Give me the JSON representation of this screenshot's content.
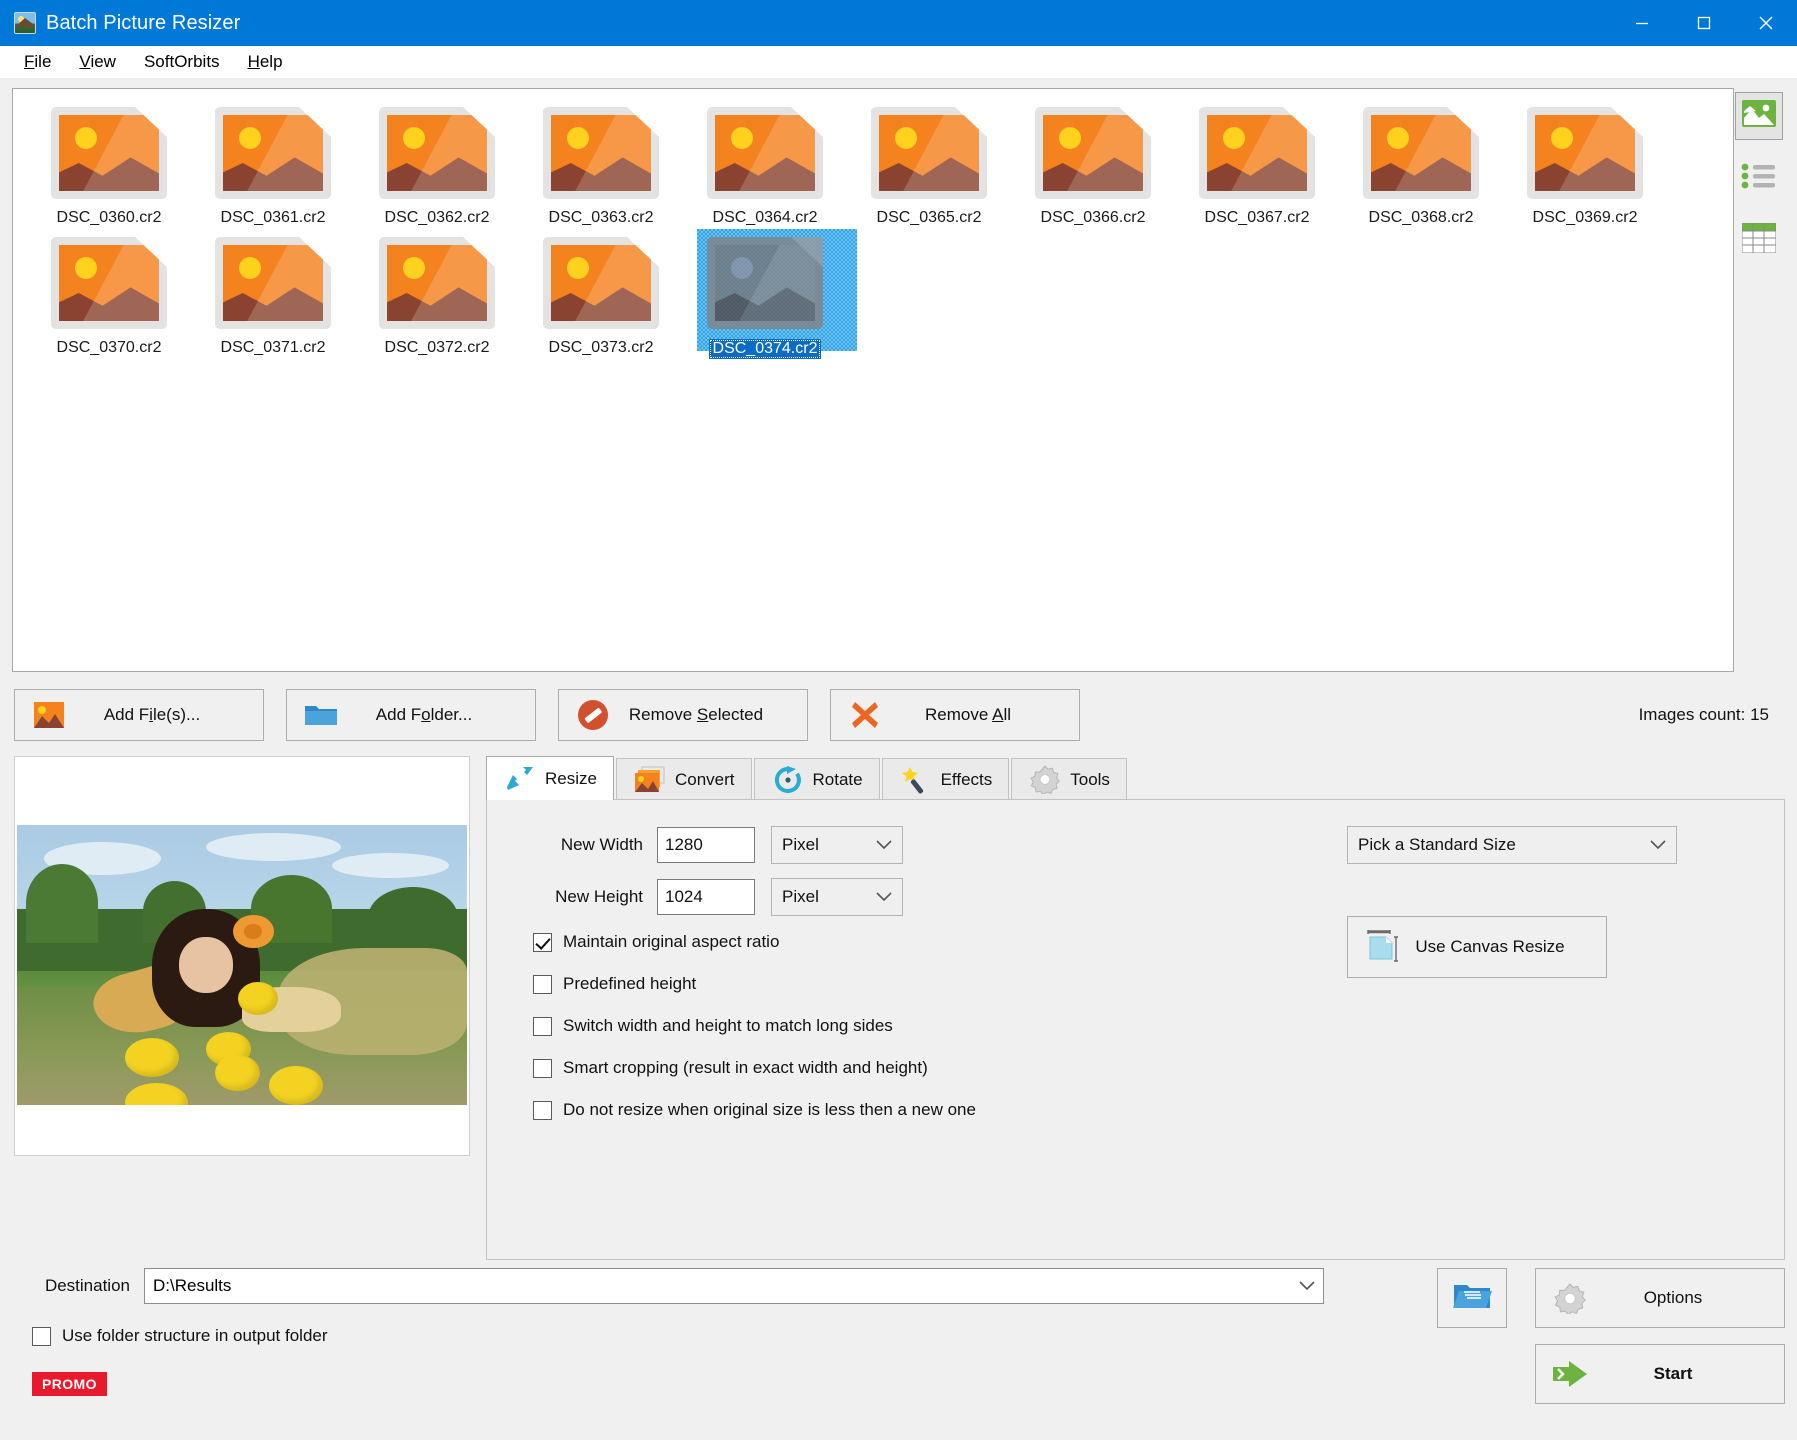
{
  "window": {
    "title": "Batch Picture Resizer",
    "icon": "app-picture-icon",
    "minimize": "—",
    "maximize": "□",
    "close": "✕"
  },
  "menu": [
    {
      "label": "File",
      "accel": "F"
    },
    {
      "label": "View",
      "accel": "V"
    },
    {
      "label": "SoftOrbits",
      "accel": ""
    },
    {
      "label": "Help",
      "accel": "H"
    }
  ],
  "file_list": {
    "items": [
      {
        "name": "DSC_0360.cr2",
        "selected": false
      },
      {
        "name": "DSC_0361.cr2",
        "selected": false
      },
      {
        "name": "DSC_0362.cr2",
        "selected": false
      },
      {
        "name": "DSC_0363.cr2",
        "selected": false
      },
      {
        "name": "DSC_0364.cr2",
        "selected": false
      },
      {
        "name": "DSC_0365.cr2",
        "selected": false
      },
      {
        "name": "DSC_0366.cr2",
        "selected": false
      },
      {
        "name": "DSC_0367.cr2",
        "selected": false
      },
      {
        "name": "DSC_0368.cr2",
        "selected": false
      },
      {
        "name": "DSC_0369.cr2",
        "selected": false
      },
      {
        "name": "DSC_0370.cr2",
        "selected": false
      },
      {
        "name": "DSC_0371.cr2",
        "selected": false
      },
      {
        "name": "DSC_0372.cr2",
        "selected": false
      },
      {
        "name": "DSC_0373.cr2",
        "selected": false
      },
      {
        "name": "DSC_0374.cr2",
        "selected": true
      }
    ],
    "count_label": "Images count: 15"
  },
  "view_modes": [
    {
      "name": "thumbnails-view",
      "icon": "picture-icon",
      "active": true
    },
    {
      "name": "list-view",
      "icon": "bullet-list-icon",
      "active": false
    },
    {
      "name": "details-view",
      "icon": "table-grid-icon",
      "active": false
    }
  ],
  "actions": {
    "add_files": {
      "label_pre": "Add F",
      "accel": "i",
      "label_post": "le(s)...",
      "icon": "picture-add-icon"
    },
    "add_folder": {
      "label_pre": "Add F",
      "accel": "o",
      "label_post": "lder...",
      "icon": "folder-icon"
    },
    "remove_selected": {
      "label_pre": "Remove ",
      "accel": "S",
      "label_post": "elected",
      "icon": "no-entry-icon"
    },
    "remove_all": {
      "label_pre": "Remove ",
      "accel": "A",
      "label_post": "ll",
      "icon": "red-x-icon"
    }
  },
  "tabs": [
    {
      "label": "Resize",
      "icon": "resize-arrow-icon",
      "active": true
    },
    {
      "label": "Convert",
      "icon": "convert-images-icon",
      "active": false
    },
    {
      "label": "Rotate",
      "icon": "rotate-circular-arrow-icon",
      "active": false
    },
    {
      "label": "Effects",
      "icon": "magic-wand-icon",
      "active": false
    },
    {
      "label": "Tools",
      "icon": "gear-icon",
      "active": false
    }
  ],
  "resize_panel": {
    "new_width": {
      "label": "New Width",
      "value": "1280",
      "unit": "Pixel"
    },
    "new_height": {
      "label": "New Height",
      "value": "1024",
      "unit": "Pixel"
    },
    "standard_size": "Pick a Standard Size",
    "canvas_resize_button": "Use Canvas Resize",
    "checkboxes": [
      {
        "label": "Maintain original aspect ratio",
        "checked": true
      },
      {
        "label": "Predefined height",
        "checked": false
      },
      {
        "label": "Switch width and height to match long sides",
        "checked": false
      },
      {
        "label": "Smart cropping (result in exact width and height)",
        "checked": false
      },
      {
        "label": "Do not resize when original size is less then a new one",
        "checked": false
      }
    ]
  },
  "bottom": {
    "destination_label": "Destination",
    "destination_value": "D:\\Results",
    "use_folder_structure": {
      "label": "Use folder structure in output folder",
      "checked": false
    },
    "promo_badge": "PROMO",
    "options_button": "Options",
    "start_button": "Start",
    "browse_icon": "open-folder-icon"
  },
  "colors": {
    "titlebar": "#0078d7",
    "accent_green": "#6cb33f",
    "accent_orange": "#f4821f",
    "selection_blue": "#0a6cc7",
    "promo_red": "#e8192c"
  }
}
